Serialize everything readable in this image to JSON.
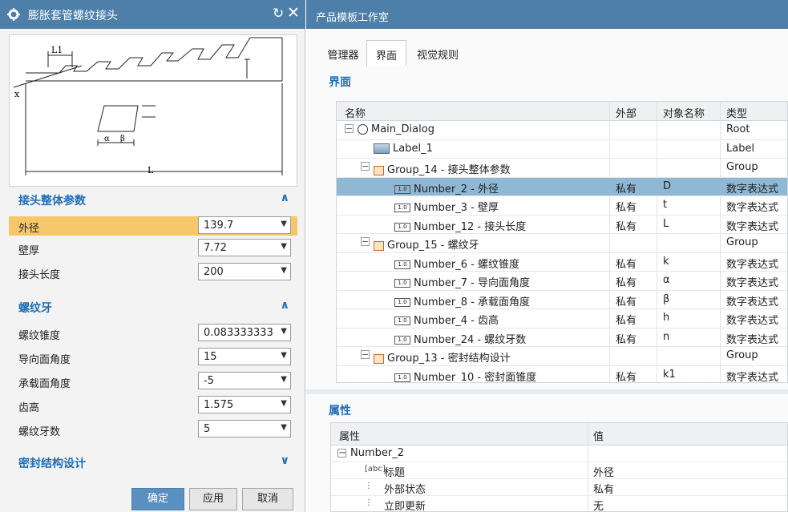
{
  "dialog": {
    "title": "膨胀套管螺纹接头",
    "diagram_labels": {
      "l1": "L1",
      "x": "x",
      "l": "L",
      "alpha": "α",
      "beta": "β"
    },
    "sections": [
      {
        "title": "接头整体参数",
        "state": "expanded",
        "rows": [
          {
            "label": "外径",
            "value": "139.7",
            "highlighted": true
          },
          {
            "label": "壁厚",
            "value": "7.72"
          },
          {
            "label": "接头长度",
            "value": "200"
          }
        ]
      },
      {
        "title": "螺纹牙",
        "state": "expanded",
        "rows": [
          {
            "label": "螺纹锥度",
            "value": "0.083333333"
          },
          {
            "label": "导向面角度",
            "value": "15"
          },
          {
            "label": "承载面角度",
            "value": "-5"
          },
          {
            "label": "齿高",
            "value": "1.575"
          },
          {
            "label": "螺纹牙数",
            "value": "5"
          }
        ]
      },
      {
        "title": "密封结构设计",
        "state": "collapsed",
        "rows": []
      }
    ],
    "buttons": {
      "ok": "确定",
      "apply": "应用",
      "cancel": "取消"
    },
    "colors": {
      "title_bar": "#4d7fa8",
      "section_title": "#1f6eb5",
      "highlight": "#f5c76a",
      "primary_button": "#5a8fc2"
    }
  },
  "studio": {
    "title": "产品模板工作室",
    "tabs": [
      "管理器",
      "界面",
      "视觉规则"
    ],
    "active_tab": "界面",
    "tree_panel_title": "界面",
    "tree_headers": [
      "名称",
      "外部",
      "对象名称",
      "类型"
    ],
    "tree_rows": [
      {
        "name": "Main_Dialog",
        "ext": "",
        "obj": "",
        "type": "Root",
        "icon": "circle-icon",
        "level": 0,
        "exp": "−"
      },
      {
        "name": "Label_1",
        "ext": "",
        "obj": "",
        "type": "Label",
        "icon": "label-icon",
        "level": 1
      },
      {
        "name": "Group_14 - 接头整体参数",
        "ext": "",
        "obj": "",
        "type": "Group",
        "icon": "group-icon",
        "level": 1,
        "exp": "−"
      },
      {
        "name": "Number_2 - 外径",
        "ext": "私有",
        "obj": "D",
        "type": "数字表达式",
        "icon": "number-icon",
        "level": 2,
        "selected": true
      },
      {
        "name": "Number_3 - 壁厚",
        "ext": "私有",
        "obj": "t",
        "type": "数字表达式",
        "icon": "number-icon",
        "level": 2
      },
      {
        "name": "Number_12 - 接头长度",
        "ext": "私有",
        "obj": "L",
        "type": "数字表达式",
        "icon": "number-icon",
        "level": 2
      },
      {
        "name": "Group_15 - 螺纹牙",
        "ext": "",
        "obj": "",
        "type": "Group",
        "icon": "group-icon",
        "level": 1,
        "exp": "−"
      },
      {
        "name": "Number_6 - 螺纹锥度",
        "ext": "私有",
        "obj": "k",
        "type": "数字表达式",
        "icon": "number-icon",
        "level": 2
      },
      {
        "name": "Number_7 - 导向面角度",
        "ext": "私有",
        "obj": "α",
        "type": "数字表达式",
        "icon": "number-icon",
        "level": 2
      },
      {
        "name": "Number_8 - 承载面角度",
        "ext": "私有",
        "obj": "β",
        "type": "数字表达式",
        "icon": "number-icon",
        "level": 2
      },
      {
        "name": "Number_4 - 齿高",
        "ext": "私有",
        "obj": "h",
        "type": "数字表达式",
        "icon": "number-icon",
        "level": 2
      },
      {
        "name": "Number_24 - 螺纹牙数",
        "ext": "私有",
        "obj": "n",
        "type": "数字表达式",
        "icon": "number-icon",
        "level": 2
      },
      {
        "name": "Group_13 - 密封结构设计",
        "ext": "",
        "obj": "",
        "type": "Group",
        "icon": "group-icon",
        "level": 1,
        "exp": "−"
      },
      {
        "name": "Number_10 - 密封面锥度",
        "ext": "私有",
        "obj": "k1",
        "type": "数字表达式",
        "icon": "number-icon",
        "level": 2
      }
    ],
    "props_panel_title": "属性",
    "props_headers": [
      "属性",
      "值"
    ],
    "props_rows": [
      {
        "name": "Number_2",
        "value": "",
        "level": 0,
        "exp": "−"
      },
      {
        "name": "标题",
        "value": "外径",
        "level": 1,
        "icon": "text-icon"
      },
      {
        "name": "外部状态",
        "value": "私有",
        "level": 1,
        "icon": "state-icon"
      },
      {
        "name": "立即更新",
        "value": "无",
        "level": 1,
        "icon": "state-icon"
      }
    ]
  }
}
